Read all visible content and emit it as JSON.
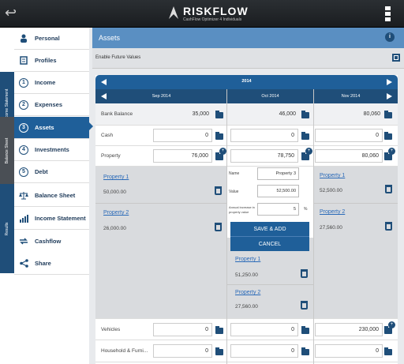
{
  "app": {
    "name": "RISKFLOW",
    "tagline": "CashFlow Optimizer 4 Individuals"
  },
  "sidebar": {
    "sections": [
      {
        "label": "Income Statement"
      },
      {
        "label": "Balance Sheet"
      },
      {
        "label": "Results"
      }
    ],
    "items": [
      {
        "label": "Personal",
        "icon": "person-icon"
      },
      {
        "label": "Profiles",
        "icon": "profiles-icon"
      },
      {
        "label": "Income",
        "num": "1"
      },
      {
        "label": "Expenses",
        "num": "2"
      },
      {
        "label": "Assets",
        "num": "3"
      },
      {
        "label": "Investments",
        "num": "4"
      },
      {
        "label": "Debt",
        "num": "5"
      },
      {
        "label": "Balance Sheet",
        "icon": "scale-icon"
      },
      {
        "label": "Income Statement",
        "icon": "chart-icon"
      },
      {
        "label": "Cashflow",
        "icon": "cashflow-icon"
      },
      {
        "label": "Share",
        "icon": "share-icon"
      }
    ]
  },
  "header": {
    "title": "Assets",
    "info": "i"
  },
  "future": {
    "label": "Enable Future Values"
  },
  "nav": {
    "year": "2014",
    "months": [
      "Sep 2014",
      "Oct 2014",
      "Nov 2014"
    ]
  },
  "rows": {
    "bank": {
      "label": "Bank Balance",
      "values": [
        "35,000",
        "46,000",
        "80,060"
      ]
    },
    "cash": {
      "label": "Cash",
      "values": [
        "0",
        "0",
        "0"
      ]
    },
    "property": {
      "label": "Property",
      "values": [
        "76,000",
        "78,750",
        "80,060"
      ]
    },
    "vehicles": {
      "label": "Vehicles",
      "values": [
        "0",
        "0",
        "230,000"
      ]
    },
    "household": {
      "label": "Household & Furni...",
      "values": [
        "0",
        "0",
        "0"
      ]
    }
  },
  "properties": {
    "col1": [
      {
        "name": "Property 1",
        "value": "50,000.00"
      },
      {
        "name": "Property 2",
        "value": "26,000.00"
      }
    ],
    "col2": [
      {
        "name": "Property 1",
        "value": "51,250.00"
      },
      {
        "name": "Property 2",
        "value": "27,560.00"
      }
    ],
    "col3": [
      {
        "name": "Property 1",
        "value": "52,500.00"
      },
      {
        "name": "Property 2",
        "value": "27,560.00"
      }
    ]
  },
  "form": {
    "name_label": "Name",
    "name_value": "Property 3",
    "value_label": "Value",
    "value_value": "52,500.00",
    "rate_label": "Annual increase in property value",
    "rate_value": "5",
    "rate_unit": "%",
    "save_label": "SAVE & ADD",
    "cancel_label": "CANCEL"
  },
  "colors": {
    "primary": "#1f4e79",
    "accent": "#1f5f99",
    "header": "#5a8fc2"
  }
}
